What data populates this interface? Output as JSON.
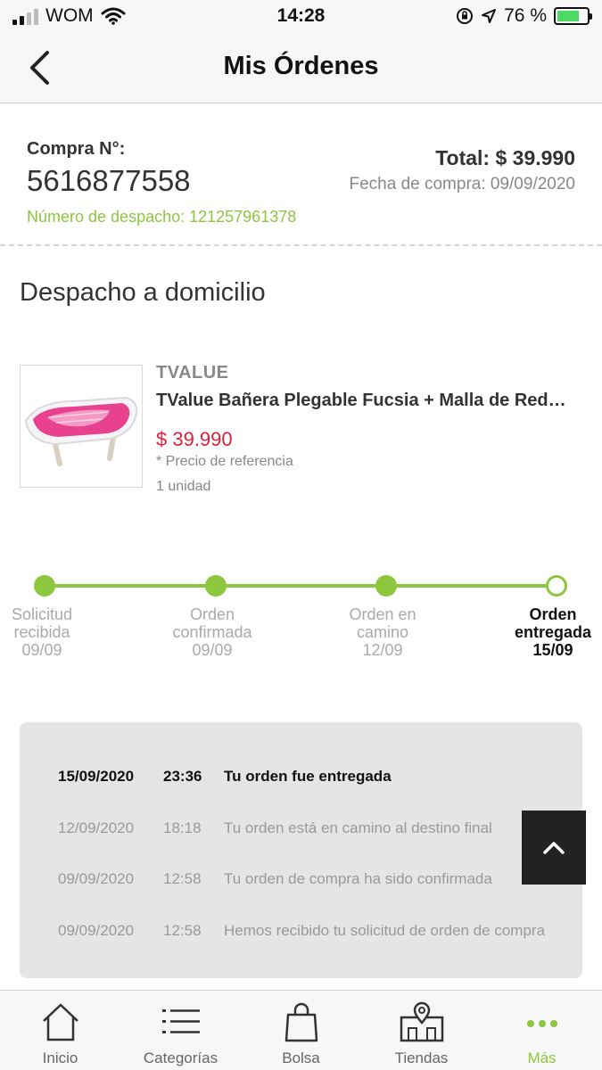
{
  "status_bar": {
    "carrier": "WOM",
    "time": "14:28",
    "battery_percent": "76 %",
    "battery_level": 0.76,
    "icons": [
      "signal-icon",
      "wifi-icon",
      "rotation-lock-icon",
      "location-arrow-icon",
      "battery-icon"
    ]
  },
  "header": {
    "title": "Mis Órdenes",
    "back_icon": "chevron-left-icon"
  },
  "order": {
    "compra_label": "Compra N°:",
    "compra_number": "5616877558",
    "despacho": "Número de despacho: 121257961378",
    "total": "Total: $ 39.990",
    "fecha": "Fecha de compra: 09/09/2020"
  },
  "section_title": "Despacho a domicilio",
  "product": {
    "brand": "TVALUE",
    "name": "TValue Bañera Plegable Fucsia + Malla de Reductor",
    "price": "$ 39.990",
    "reference": "* Precio de referencia",
    "quantity": "1 unidad"
  },
  "tracking": {
    "steps": [
      {
        "line1": "Solicitud",
        "line2": "recibida",
        "date": "09/09",
        "done": true
      },
      {
        "line1": "Orden",
        "line2": "confirmada",
        "date": "09/09",
        "done": true
      },
      {
        "line1": "Orden en",
        "line2": "camino",
        "date": "12/09",
        "done": true
      },
      {
        "line1": "Orden",
        "line2": "entregada",
        "date": "15/09",
        "done": false
      }
    ]
  },
  "history": [
    {
      "date": "15/09/2020",
      "time": "23:36",
      "message": "Tu orden fue entregada"
    },
    {
      "date": "12/09/2020",
      "time": "18:18",
      "message": "Tu orden está en camino al destino final"
    },
    {
      "date": "09/09/2020",
      "time": "12:58",
      "message": "Tu orden de compra ha sido confirmada"
    },
    {
      "date": "09/09/2020",
      "time": "12:58",
      "message": "Hemos recibido tu solicitud de orden de compra"
    }
  ],
  "scroll_top_icon": "chevron-up-icon",
  "nav": [
    {
      "label": "Inicio",
      "icon": "home-icon"
    },
    {
      "label": "Categorías",
      "icon": "list-icon"
    },
    {
      "label": "Bolsa",
      "icon": "shopping-bag-icon"
    },
    {
      "label": "Tiendas",
      "icon": "store-map-icon"
    },
    {
      "label": "Más",
      "icon": "more-dots-icon"
    }
  ],
  "colors": {
    "accent": "#8dc63f",
    "price": "#e0203a",
    "panel": "#e5e5e5"
  }
}
